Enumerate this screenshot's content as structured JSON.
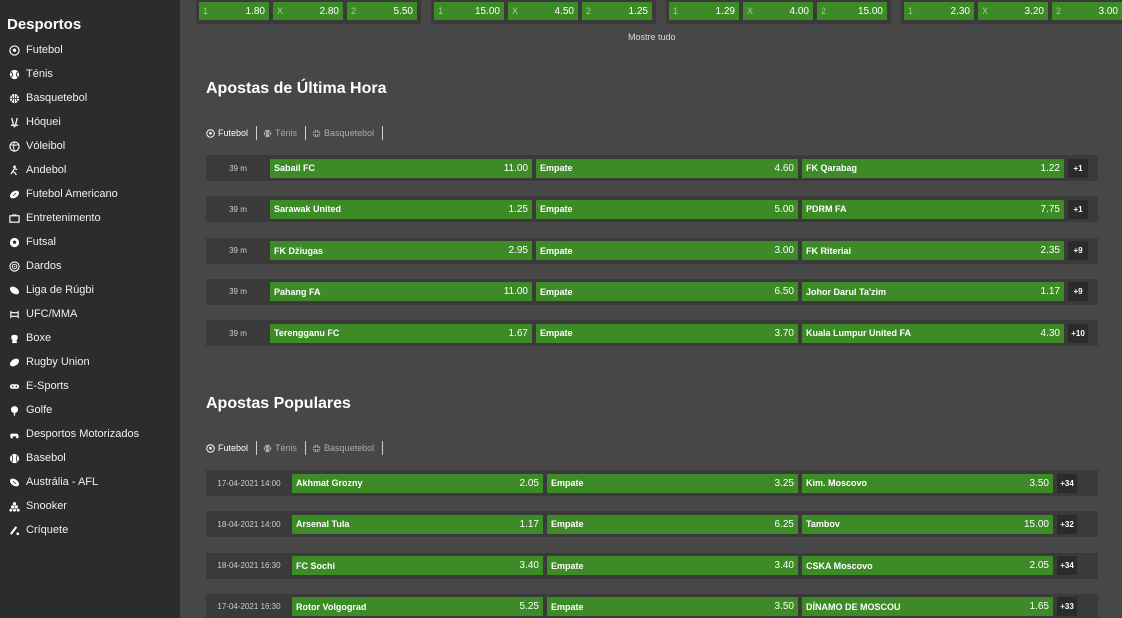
{
  "sidebar": {
    "title": "Desportos",
    "items": [
      {
        "label": "Futebol",
        "icon": "soccer-ball-icon"
      },
      {
        "label": "Ténis",
        "icon": "tennis-ball-icon"
      },
      {
        "label": "Basquetebol",
        "icon": "basketball-icon"
      },
      {
        "label": "Hóquei",
        "icon": "hockey-icon"
      },
      {
        "label": "Vóleibol",
        "icon": "volleyball-icon"
      },
      {
        "label": "Andebol",
        "icon": "handball-icon"
      },
      {
        "label": "Futebol Americano",
        "icon": "american-football-icon"
      },
      {
        "label": "Entretenimento",
        "icon": "tv-icon"
      },
      {
        "label": "Futsal",
        "icon": "futsal-icon"
      },
      {
        "label": "Dardos",
        "icon": "darts-icon"
      },
      {
        "label": "Liga de Rúgbi",
        "icon": "rugby-league-icon"
      },
      {
        "label": "UFC/MMA",
        "icon": "mma-icon"
      },
      {
        "label": "Boxe",
        "icon": "boxing-icon"
      },
      {
        "label": "Rugby Union",
        "icon": "rugby-union-icon"
      },
      {
        "label": "E-Sports",
        "icon": "gamepad-icon"
      },
      {
        "label": "Golfe",
        "icon": "golf-icon"
      },
      {
        "label": "Desportos Motorizados",
        "icon": "motorsport-icon"
      },
      {
        "label": "Basebol",
        "icon": "baseball-icon"
      },
      {
        "label": "Austrália - AFL",
        "icon": "afl-icon"
      },
      {
        "label": "Snooker",
        "icon": "snooker-icon"
      },
      {
        "label": "Críquete",
        "icon": "cricket-icon"
      }
    ]
  },
  "top_strip": {
    "groups": [
      [
        {
          "k": "1",
          "v": "1.80"
        },
        {
          "k": "X",
          "v": "2.80"
        },
        {
          "k": "2",
          "v": "5.50"
        }
      ],
      [
        {
          "k": "1",
          "v": "15.00"
        },
        {
          "k": "X",
          "v": "4.50"
        },
        {
          "k": "2",
          "v": "1.25"
        }
      ],
      [
        {
          "k": "1",
          "v": "1.29"
        },
        {
          "k": "X",
          "v": "4.00"
        },
        {
          "k": "2",
          "v": "15.00"
        }
      ],
      [
        {
          "k": "1",
          "v": "2.30"
        },
        {
          "k": "X",
          "v": "3.20"
        },
        {
          "k": "2",
          "v": "3.00"
        }
      ]
    ],
    "show_all": "Mostre tudo"
  },
  "last_hour": {
    "title": "Apostas de Última Hora",
    "tabs": [
      "Futebol",
      "Ténis",
      "Basquetebol"
    ],
    "rows": [
      {
        "time": "39 m",
        "home": "Sabail FC",
        "home_odd": "11.00",
        "draw": "Empate",
        "draw_odd": "4.60",
        "away": "FK Qarabag",
        "away_odd": "1.22",
        "more": "+1"
      },
      {
        "time": "39 m",
        "home": "Sarawak United",
        "home_odd": "1.25",
        "draw": "Empate",
        "draw_odd": "5.00",
        "away": "PDRM FA",
        "away_odd": "7.75",
        "more": "+1"
      },
      {
        "time": "39 m",
        "home": "FK Džiugas",
        "home_odd": "2.95",
        "draw": "Empate",
        "draw_odd": "3.00",
        "away": "FK Riteriai",
        "away_odd": "2.35",
        "more": "+9"
      },
      {
        "time": "39 m",
        "home": "Pahang FA",
        "home_odd": "11.00",
        "draw": "Empate",
        "draw_odd": "6.50",
        "away": "Johor Darul Ta'zim",
        "away_odd": "1.17",
        "more": "+9"
      },
      {
        "time": "39 m",
        "home": "Terengganu FC",
        "home_odd": "1.67",
        "draw": "Empate",
        "draw_odd": "3.70",
        "away": "Kuala Lumpur United FA",
        "away_odd": "4.30",
        "more": "+10"
      }
    ]
  },
  "popular": {
    "title": "Apostas Populares",
    "tabs": [
      "Futebol",
      "Ténis",
      "Basquetebol"
    ],
    "rows": [
      {
        "time": "17-04-2021 14:00",
        "home": "Akhmat Grozny",
        "home_odd": "2.05",
        "draw": "Empate",
        "draw_odd": "3.25",
        "away": "Kim. Moscovo",
        "away_odd": "3.50",
        "more": "+34"
      },
      {
        "time": "18-04-2021 14:00",
        "home": "Arsenal Tula",
        "home_odd": "1.17",
        "draw": "Empate",
        "draw_odd": "6.25",
        "away": "Tambov",
        "away_odd": "15.00",
        "more": "+32"
      },
      {
        "time": "18-04-2021 16:30",
        "home": "FC Sochi",
        "home_odd": "3.40",
        "draw": "Empate",
        "draw_odd": "3.40",
        "away": "CSKA Moscovo",
        "away_odd": "2.05",
        "more": "+34"
      },
      {
        "time": "17-04-2021 16:30",
        "home": "Rotor Volgograd",
        "home_odd": "5.25",
        "draw": "Empate",
        "draw_odd": "3.50",
        "away": "DÍNAMO DE MOSCOU",
        "away_odd": "1.65",
        "more": "+33"
      }
    ]
  }
}
